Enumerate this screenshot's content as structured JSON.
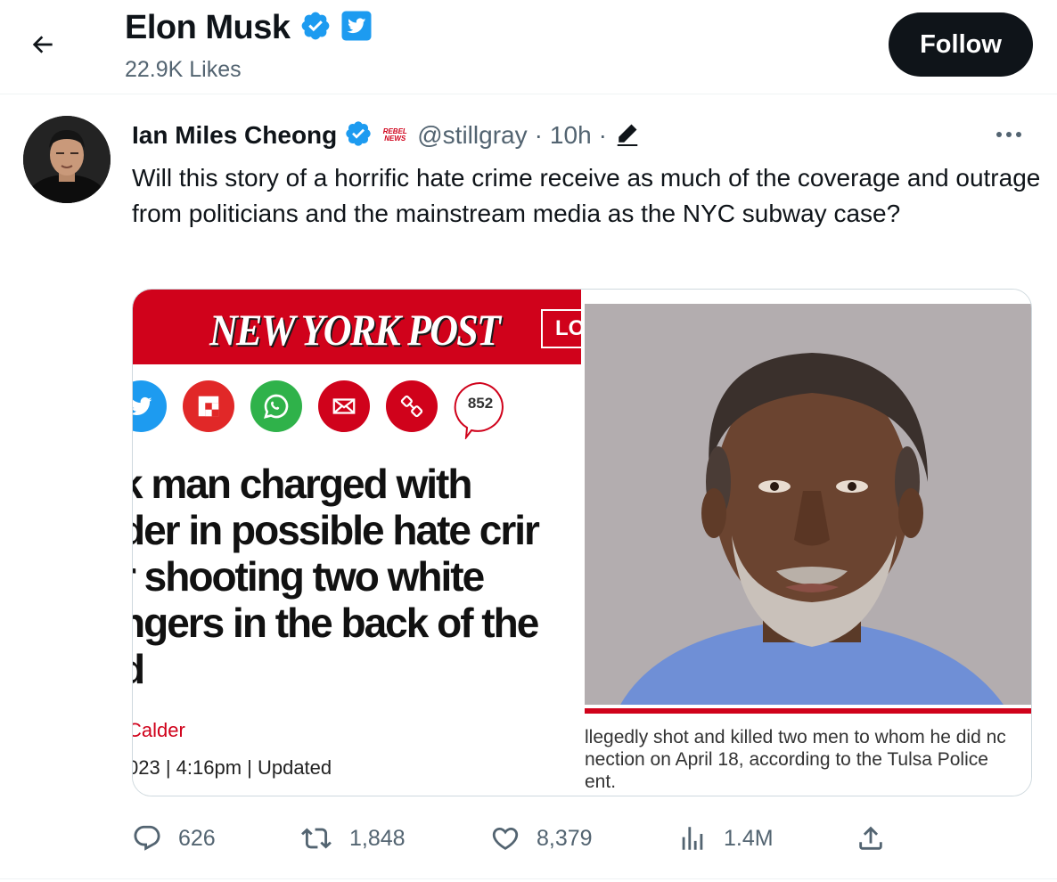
{
  "header": {
    "profile_name": "Elon Musk",
    "stat": "22.9K Likes",
    "follow_label": "Follow"
  },
  "tweet": {
    "author_name": "Ian Miles Cheong",
    "handle": "@stillgray",
    "separator": "·",
    "time": "10h",
    "separator2": "·",
    "text": "Will this story of a horrific hate crime receive as much of the coverage and outrage from politicians and the mainstream media as the NYC subway case?",
    "badge_text": "REBEL NEWS"
  },
  "media": {
    "logo": "NEW YORK POST",
    "logo_box": "LO",
    "comment_count": "852",
    "headline_lines": [
      "k man charged with",
      "der in possible hate crir",
      "r shooting two white",
      "ngers in the back of the",
      "d"
    ],
    "byline": "Calder",
    "dateline": "023 | 4:16pm | Updated",
    "caption": "llegedly shot and killed two men to whom he did nc\nnection on April 18, according to the Tulsa Police\nent."
  },
  "actions": {
    "replies": "626",
    "retweets": "1,848",
    "likes": "8,379",
    "views": "1.4M"
  },
  "colors": {
    "brand_blue": "#1d9bf0",
    "nyp_red": "#d0021b",
    "follow_bg": "#0f1419",
    "muted": "#536471"
  },
  "icons": [
    "back-arrow-icon",
    "verified-badge-icon",
    "twitter-bird-icon",
    "edit-pencil-icon",
    "more-dots-icon",
    "reply-icon",
    "retweet-icon",
    "like-icon",
    "views-icon",
    "share-icon"
  ]
}
